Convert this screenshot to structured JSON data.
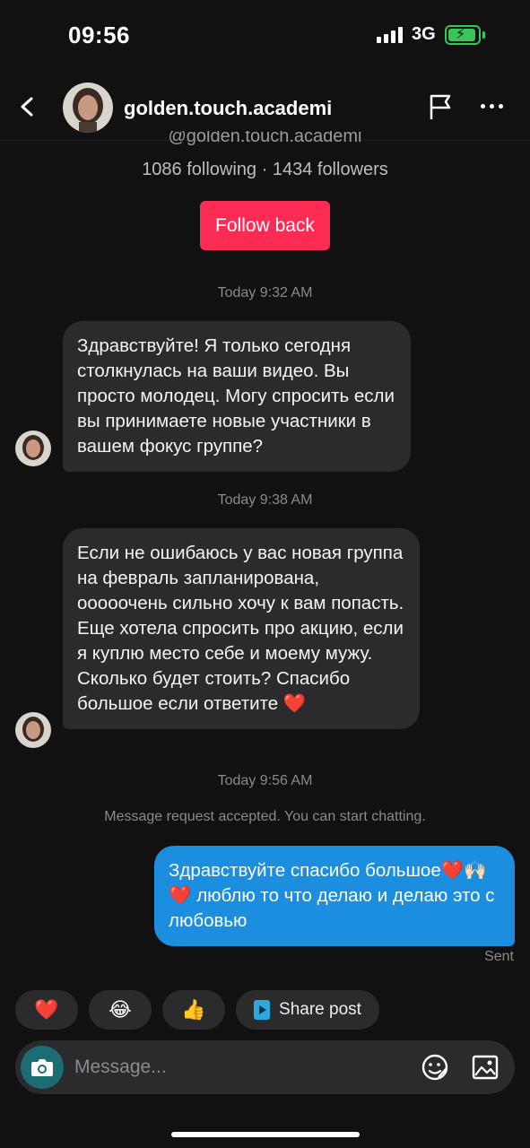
{
  "status_bar": {
    "time": "09:56",
    "network": "3G",
    "battery_percent": 75,
    "battery_color": "#34c759"
  },
  "header": {
    "username": "golden.touch.academi",
    "back_icon": "chevron-left-icon",
    "report_icon": "flag-icon",
    "more_icon": "more-horizontal-icon"
  },
  "profile": {
    "handle": "@golden.touch.academi",
    "follow_stats": "1086 following · 1434 followers",
    "follow_button": "Follow back",
    "follow_button_color": "#fe2c55"
  },
  "conversation": {
    "timestamps": [
      "Today 9:32 AM",
      "Today 9:38 AM",
      "Today 9:56 AM"
    ],
    "messages": [
      {
        "direction": "incoming",
        "text": "Здравствуйте! Я только сегодня столкнулась на ваши видео. Вы просто молодец. Могу спросить если вы принимаете новые участники в вашем фокус группе?"
      },
      {
        "direction": "incoming",
        "text": "Если не ошибаюсь у вас новая группа на февраль запланирована, ооооочень сильно хочу к вам попасть. Еще хотела спросить про акцию, если я куплю место себе и моему мужу. Сколько будет стоить? Спасибо большое если ответите ❤️"
      },
      {
        "direction": "outgoing",
        "text": "Здравствуйте спасибо большое❤️🙌🏻❤️ люблю то что делаю и делаю это с любовью"
      }
    ],
    "system_note": "Message request accepted. You can start chatting.",
    "sent_label": "Sent"
  },
  "quick_replies": {
    "heart": "❤️",
    "laugh": "😂",
    "thumbs_up": "👍",
    "share_post": "Share post"
  },
  "composer": {
    "placeholder": "Message...",
    "camera_icon": "camera-icon",
    "sticker_icon": "sticker-icon",
    "image_icon": "image-icon"
  }
}
